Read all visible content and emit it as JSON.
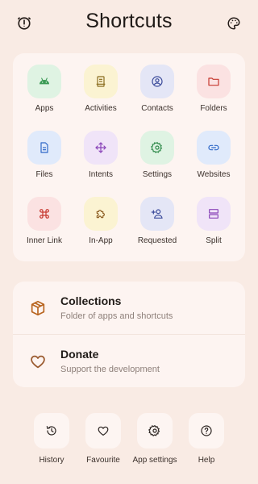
{
  "header": {
    "title": "Shortcuts",
    "left_icon": "info-alert-icon",
    "right_icon": "palette-icon"
  },
  "grid": [
    {
      "label": "Apps",
      "icon": "android-icon",
      "bg": "#dff3e3",
      "fg": "#3b9a55"
    },
    {
      "label": "Activities",
      "icon": "clipboard-icon",
      "bg": "#fbf3d2",
      "fg": "#8a6d1f"
    },
    {
      "label": "Contacts",
      "icon": "account-circle-icon",
      "bg": "#e4e6f6",
      "fg": "#3a4a9a"
    },
    {
      "label": "Folders",
      "icon": "folder-icon",
      "bg": "#fbe2e2",
      "fg": "#c6382f"
    },
    {
      "label": "Files",
      "icon": "document-icon",
      "bg": "#e0eafb",
      "fg": "#2f68c8"
    },
    {
      "label": "Intents",
      "icon": "move-arrows-icon",
      "bg": "#f0e4f8",
      "fg": "#8a45b8"
    },
    {
      "label": "Settings",
      "icon": "gear-icon",
      "bg": "#dff3e3",
      "fg": "#2f8a4a"
    },
    {
      "label": "Websites",
      "icon": "link-icon",
      "bg": "#e0eafb",
      "fg": "#2f68c8"
    },
    {
      "label": "Inner Link",
      "icon": "command-icon",
      "bg": "#fbe2e2",
      "fg": "#c6382f"
    },
    {
      "label": "In-App",
      "icon": "puzzle-icon",
      "bg": "#fbf3d2",
      "fg": "#8a5a1f"
    },
    {
      "label": "Requested",
      "icon": "person-add-icon",
      "bg": "#e4e6f6",
      "fg": "#3a4a9a"
    },
    {
      "label": "Split",
      "icon": "split-icon",
      "bg": "#f0e4f8",
      "fg": "#8a45b8"
    }
  ],
  "list": [
    {
      "title": "Collections",
      "subtitle": "Folder of apps and shortcuts",
      "icon": "box-icon",
      "color": "#b8641f"
    },
    {
      "title": "Donate",
      "subtitle": "Support the development",
      "icon": "heart-outline-icon",
      "color": "#9a5a2f"
    }
  ],
  "bottom": [
    {
      "label": "History",
      "icon": "history-icon"
    },
    {
      "label": "Favourite",
      "icon": "heart-icon"
    },
    {
      "label": "App settings",
      "icon": "gear-icon"
    },
    {
      "label": "Help",
      "icon": "help-icon"
    }
  ],
  "colors": {
    "background": "#f9ebe4",
    "card": "#fdf4f1",
    "text": "#231b17",
    "muted": "#8f817b"
  }
}
